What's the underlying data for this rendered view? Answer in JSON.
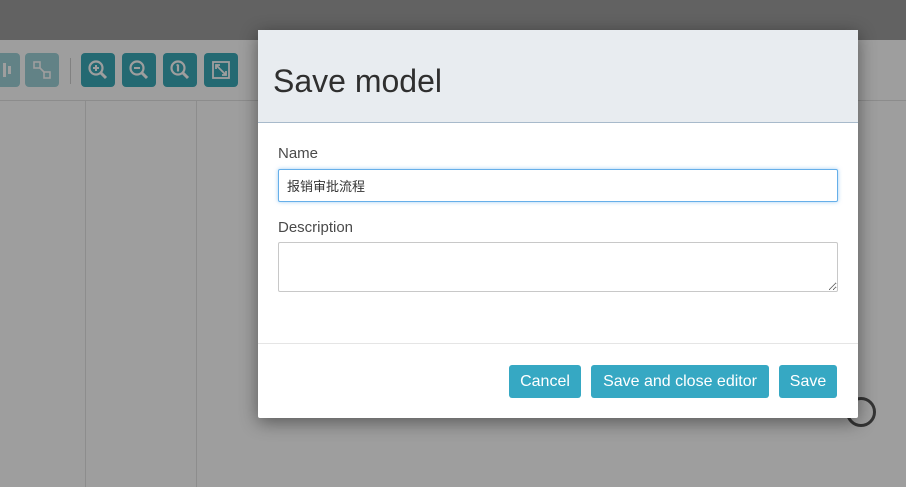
{
  "toolbar": {
    "icons": [
      "vertical-align-icon",
      "connector-icon",
      "zoom-in-icon",
      "zoom-out-icon",
      "zoom-actual-icon",
      "zoom-fit-icon"
    ]
  },
  "modal": {
    "title": "Save model",
    "name_label": "Name",
    "name_value": "报销审批流程",
    "description_label": "Description",
    "description_value": "",
    "buttons": {
      "cancel": "Cancel",
      "save_and_close": "Save and close editor",
      "save": "Save"
    }
  },
  "colors": {
    "accent": "#36a8c3",
    "header_bg": "#e8ecf0",
    "focus_border": "#66afe9"
  }
}
